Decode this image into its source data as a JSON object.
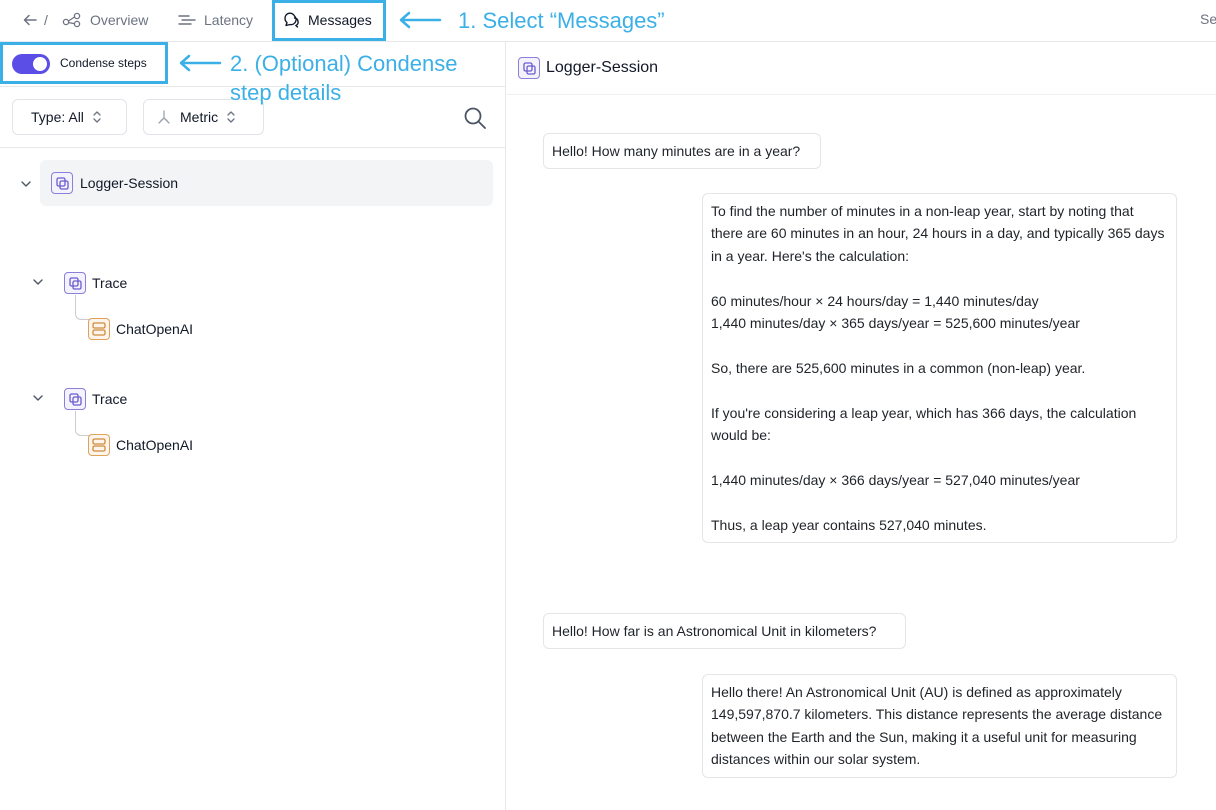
{
  "nav": {
    "back_sep": "/",
    "tabs": [
      {
        "label": "Overview",
        "icon": "nodes-icon"
      },
      {
        "label": "Latency",
        "icon": "bars-icon"
      },
      {
        "label": "Messages",
        "icon": "chat-icon",
        "active": true
      }
    ],
    "cut_text": "Se"
  },
  "annotations": {
    "step1": "1. Select “Messages”",
    "step2_line1": "2. (Optional) Condense",
    "step2_line2": "step details",
    "color": "#3bb0e6"
  },
  "left": {
    "toggle_label": "Condense steps",
    "toggle_on": true,
    "accent": "#5b4ee6",
    "filter_type": "Type: All",
    "filter_metric": "Metric",
    "tree": {
      "root": "Logger-Session",
      "traces": [
        {
          "label": "Trace",
          "child": "ChatOpenAI"
        },
        {
          "label": "Trace",
          "child": "ChatOpenAI"
        }
      ]
    }
  },
  "right": {
    "title": "Logger-Session",
    "messages": [
      {
        "role": "user",
        "text": "Hello! How many minutes are in a year?"
      },
      {
        "role": "assistant",
        "text": "To find the number of minutes in a non-leap year, start by noting that there are 60 minutes in an hour, 24 hours in a day, and typically 365 days in a year. Here's the calculation:\n\n60 minutes/hour × 24 hours/day = 1,440 minutes/day\n1,440 minutes/day × 365 days/year = 525,600 minutes/year\n\nSo, there are 525,600 minutes in a common (non-leap) year.\n\nIf you're considering a leap year, which has 366 days, the calculation would be:\n\n1,440 minutes/day × 366 days/year = 527,040 minutes/year\n\nThus, a leap year contains 527,040 minutes."
      },
      {
        "role": "user",
        "text": "Hello! How far is an Astronomical Unit in kilometers?"
      },
      {
        "role": "assistant",
        "text": "Hello there! An Astronomical Unit (AU) is defined as approximately 149,597,870.7 kilometers. This distance represents the average distance between the Earth and the Sun, making it a useful unit for measuring distances within our solar system."
      }
    ]
  }
}
